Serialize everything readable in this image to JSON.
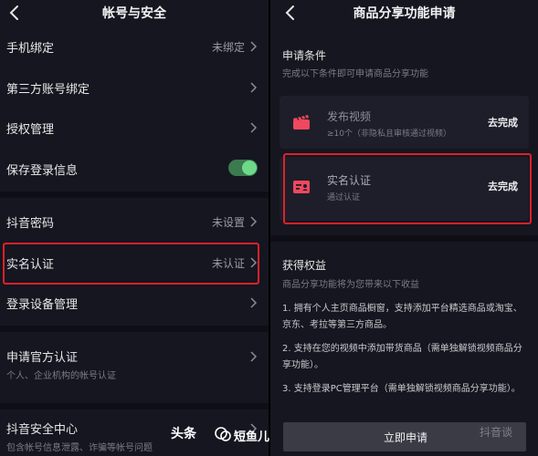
{
  "left": {
    "title": "帐号与安全",
    "rows": [
      {
        "label": "手机绑定",
        "value": "未绑定"
      },
      {
        "label": "第三方账号绑定"
      },
      {
        "label": "授权管理"
      },
      {
        "label": "保存登录信息"
      },
      {
        "label": "抖音密码",
        "value": "未设置"
      },
      {
        "label": "实名认证",
        "value": "未认证"
      },
      {
        "label": "登录设备管理"
      },
      {
        "label": "申请官方认证",
        "sub": "个人、企业机构的帐号认证"
      },
      {
        "label": "抖音安全中心",
        "sub": "包含帐号信息泄露、诈骗等帐号问题"
      }
    ]
  },
  "right": {
    "title": "商品分享功能申请",
    "conditions": {
      "title": "申请条件",
      "desc": "完成以下条件即可申请商品分享功能",
      "cards": [
        {
          "title": "发布视频",
          "sub": "≥10个（非隐私且审核通过视频）",
          "action": "去完成"
        },
        {
          "title": "实名认证",
          "sub": "通过认证",
          "action": "去完成"
        }
      ]
    },
    "benefits": {
      "title": "获得权益",
      "desc": "商品分享功能将为您带来以下收益",
      "items": [
        "1. 拥有个人主页商品橱窗，支持添加平台精选商品或淘宝、京东、考拉等第三方商品。",
        "2. 支持在您的视频中添加带货商品（需单独解锁视频商品分享功能）。",
        "3. 支持登录PC管理平台（需单独解锁视频商品分享功能）。"
      ]
    },
    "apply_label": "立即申请"
  },
  "watermark": {
    "text_left": "头条",
    "text_right": "短鱼儿",
    "faint": "抖音谈"
  },
  "colors": {
    "background": "#15161f",
    "highlight": "#e0202a",
    "toggle_on": "#6fd98a",
    "card": "#1d1e2a",
    "icon_red": "#f0485e"
  }
}
